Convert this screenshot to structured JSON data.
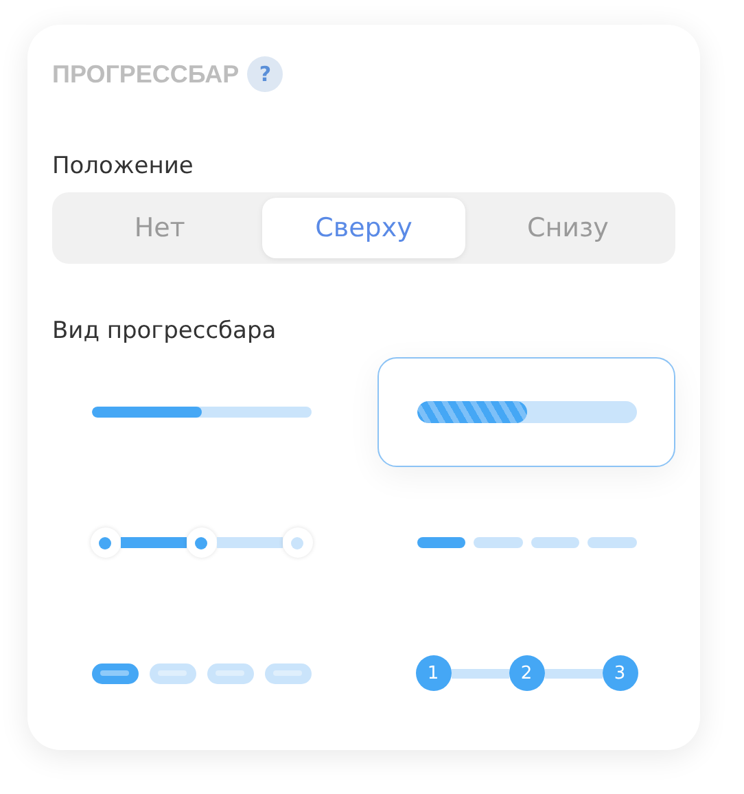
{
  "title": "ПРОГРЕССБАР",
  "help": "?",
  "position": {
    "label": "Положение",
    "tabs": [
      {
        "label": "Нет",
        "selected": false
      },
      {
        "label": "Сверху",
        "selected": true
      },
      {
        "label": "Снизу",
        "selected": false
      }
    ]
  },
  "style": {
    "label": "Вид прогрессбара",
    "options": [
      {
        "kind": "line",
        "selected": false,
        "level": 0.5
      },
      {
        "kind": "striped",
        "selected": true,
        "level": 0.5
      },
      {
        "kind": "dots",
        "selected": false
      },
      {
        "kind": "segments",
        "selected": false,
        "level": 0.25
      },
      {
        "kind": "pills",
        "selected": false
      },
      {
        "kind": "steps",
        "selected": false,
        "steps": [
          "1",
          "2",
          "3"
        ]
      }
    ]
  }
}
